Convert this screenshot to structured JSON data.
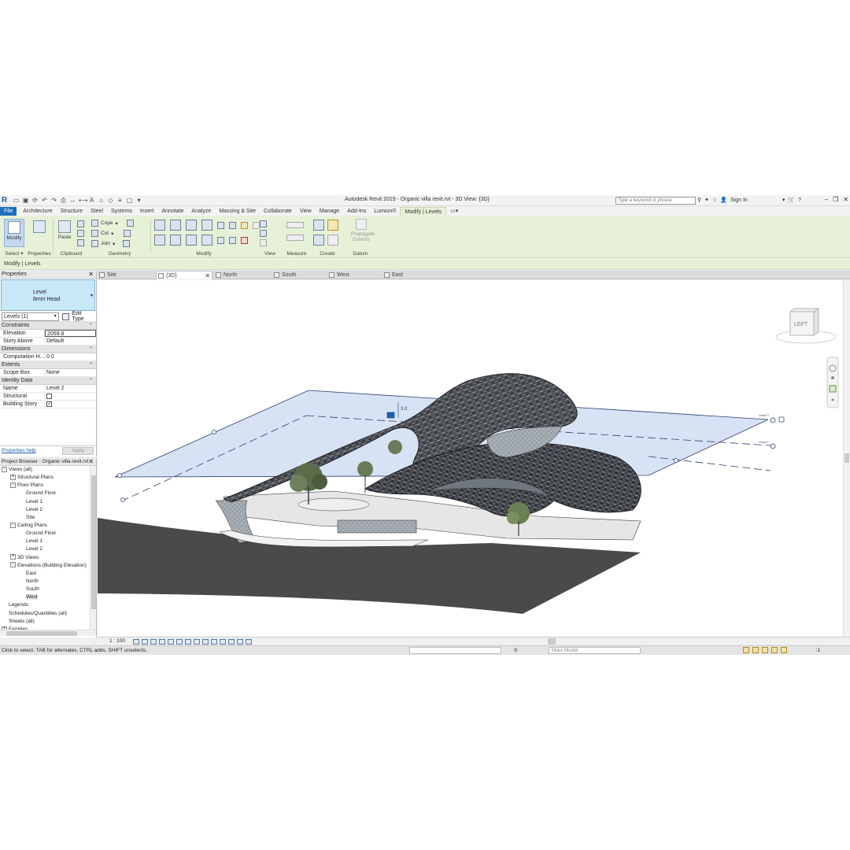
{
  "app": {
    "title": "Autodesk Revit 2019 - Organic villa revit.rvt - 3D View: {3D}",
    "logo": "R",
    "search_placeholder": "Type a keyword or phrase",
    "sign_in": "Sign In"
  },
  "tabs": [
    "File",
    "Architecture",
    "Structure",
    "Steel",
    "Systems",
    "Insert",
    "Annotate",
    "Analyze",
    "Massing & Site",
    "Collaborate",
    "View",
    "Manage",
    "Add-Ins",
    "Lumion®",
    "Modify | Levels"
  ],
  "ribbon": {
    "modify": "Modify",
    "select": "Select ▾",
    "properties": "Properties",
    "paste": "Paste",
    "clipboard": "Clipboard",
    "cope": "Cope",
    "cut": "Cut",
    "join": "Join",
    "geometry": "Geometry",
    "modify_panel": "Modify",
    "view": "View",
    "measure": "Measure",
    "create": "Create",
    "propagate_1": "Propagate",
    "propagate_2": "Extents",
    "datum": "Datum"
  },
  "context_bar": "Modify | Levels",
  "properties": {
    "header": "Properties",
    "type_line1": "Level",
    "type_line2": "8mm Head",
    "instance": "Levels (1)",
    "edit_type": "Edit Type",
    "groups": {
      "constraints": "Constraints",
      "dimensions": "Dimensions",
      "extents": "Extents",
      "identity": "Identity Data"
    },
    "rows": {
      "elevation_k": "Elevation",
      "elevation_v": "2059.8",
      "story_above_k": "Story Above",
      "story_above_v": "Default",
      "computation_k": "Computation H...",
      "computation_v": "0.0",
      "scope_box_k": "Scope Box",
      "scope_box_v": "None",
      "name_k": "Name",
      "name_v": "Level 2",
      "structural_k": "Structural",
      "building_story_k": "Building Story"
    },
    "help": "Properties help",
    "apply": "Apply"
  },
  "browser": {
    "header": "Project Browser - Organic villa revit.rvt",
    "nodes": [
      {
        "label": "Views (all)",
        "level": 0,
        "toggle": "−"
      },
      {
        "label": "Structural Plans",
        "level": 1,
        "toggle": "+"
      },
      {
        "label": "Floor Plans",
        "level": 1,
        "toggle": "−"
      },
      {
        "label": "Ground Floor",
        "level": 2,
        "toggle": ""
      },
      {
        "label": "Level 1",
        "level": 2,
        "toggle": ""
      },
      {
        "label": "Level 2",
        "level": 2,
        "toggle": ""
      },
      {
        "label": "Site",
        "level": 2,
        "toggle": ""
      },
      {
        "label": "Ceiling Plans",
        "level": 1,
        "toggle": "−"
      },
      {
        "label": "Ground Floor",
        "level": 2,
        "toggle": ""
      },
      {
        "label": "Level 1",
        "level": 2,
        "toggle": ""
      },
      {
        "label": "Level 2",
        "level": 2,
        "toggle": ""
      },
      {
        "label": "3D Views",
        "level": 1,
        "toggle": "+"
      },
      {
        "label": "Elevations (Building Elevation)",
        "level": 1,
        "toggle": "−"
      },
      {
        "label": "East",
        "level": 2,
        "toggle": ""
      },
      {
        "label": "North",
        "level": 2,
        "toggle": ""
      },
      {
        "label": "South",
        "level": 2,
        "toggle": ""
      },
      {
        "label": "West",
        "level": 2,
        "toggle": "",
        "selected": true
      },
      {
        "label": "Legends",
        "level": 0,
        "toggle": ""
      },
      {
        "label": "Schedules/Quantities (all)",
        "level": 0,
        "toggle": ""
      },
      {
        "label": "Sheets (all)",
        "level": 0,
        "toggle": ""
      },
      {
        "label": "Families",
        "level": 0,
        "toggle": "+"
      }
    ]
  },
  "view_tabs": [
    {
      "label": "Site",
      "active": false
    },
    {
      "label": "{3D}",
      "active": true
    },
    {
      "label": "North",
      "active": false
    },
    {
      "label": "South",
      "active": false
    },
    {
      "label": "West",
      "active": false
    },
    {
      "label": "East",
      "active": false
    }
  ],
  "viewport": {
    "viewcube_face": "LEFT",
    "level_tag_1": "Level 2",
    "level_tag_2": "Level 1",
    "dim_text": "3.0"
  },
  "view_control": {
    "scale": "1 : 100"
  },
  "status": {
    "message": "Click to select, TAB for alternates, CTRL adds, SHIFT unselects.",
    "zero": ":0",
    "model": "Main Model",
    "filter": ":1"
  },
  "colors": {
    "file_tab": "#1e6ebf",
    "ribbon_context": "#e7f1d8",
    "level_plane": "#c9d9f0",
    "terrain": "#4a4a4a",
    "shell": "#3c3f44"
  }
}
